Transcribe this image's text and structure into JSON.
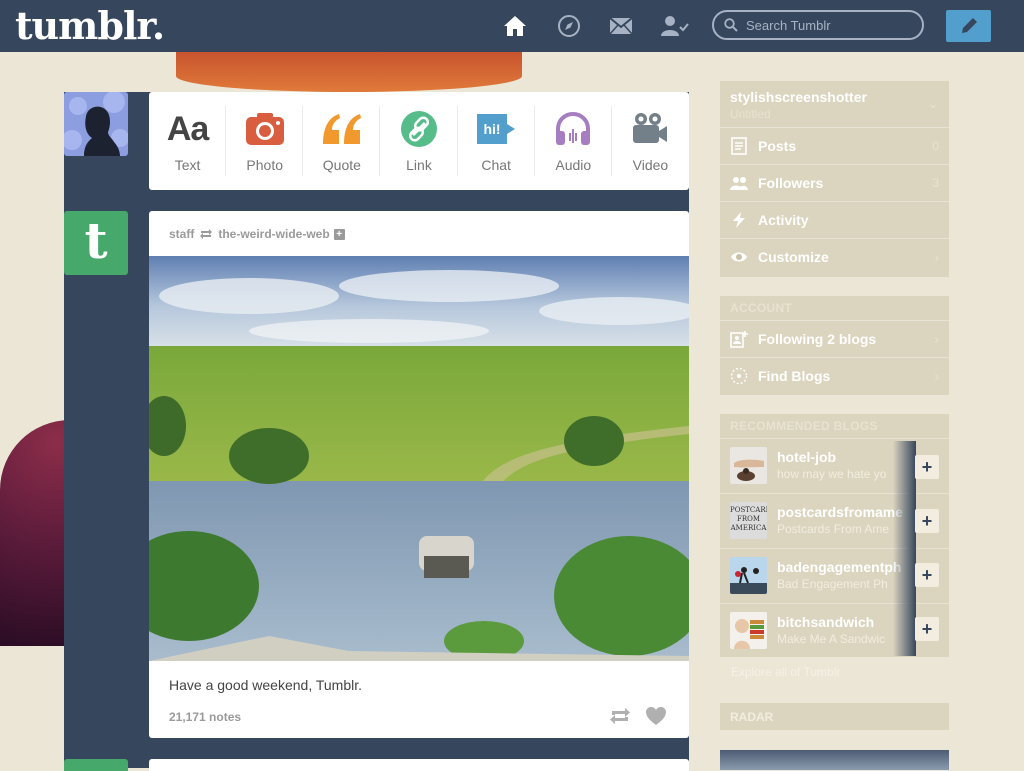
{
  "header": {
    "logo": "tumblr.",
    "search_placeholder": "Search Tumblr",
    "icons": [
      "home-icon",
      "explore-icon",
      "inbox-icon",
      "account-icon",
      "compose-icon"
    ]
  },
  "post_types": [
    {
      "label": "Text",
      "glyph": "Aa",
      "color": "#444444"
    },
    {
      "label": "Photo",
      "color": "#d95e40"
    },
    {
      "label": "Quote",
      "color": "#f2992e"
    },
    {
      "label": "Link",
      "color": "#56bc8a"
    },
    {
      "label": "Chat",
      "glyph": "hi!",
      "color": "#529ecc"
    },
    {
      "label": "Audio",
      "color": "#a77dc2"
    },
    {
      "label": "Video",
      "color": "#748089"
    }
  ],
  "post": {
    "author": "staff",
    "reblogged_from": "the-weird-wide-web",
    "caption": "Have a good weekend, Tumblr.",
    "notes": "21,171 notes"
  },
  "sidebar": {
    "blog": {
      "name": "stylishscreenshotter",
      "subtitle": "Untitled"
    },
    "blog_items": [
      {
        "label": "Posts",
        "count": "0"
      },
      {
        "label": "Followers",
        "count": "3"
      },
      {
        "label": "Activity",
        "count": ""
      },
      {
        "label": "Customize",
        "count": ""
      }
    ],
    "account_title": "ACCOUNT",
    "account_items": [
      {
        "label": "Following 2 blogs"
      },
      {
        "label": "Find Blogs"
      }
    ],
    "recommended_title": "RECOMMENDED BLOGS",
    "recommended": [
      {
        "name": "hotel-job",
        "subtitle": "how may we hate yo"
      },
      {
        "name": "postcardsfromame",
        "subtitle": "Postcards From Ame"
      },
      {
        "name": "badengagementph",
        "subtitle": "Bad Engagement Ph"
      },
      {
        "name": "bitchsandwich",
        "subtitle": "Make Me A Sandwic"
      }
    ],
    "thumb2_text": "POSTCARDS FROM AMERICA",
    "follow_label": "+",
    "explore": "Explore all of Tumblr",
    "radar_title": "RADAR"
  },
  "colors": {
    "nav": "#36465d",
    "accent": "#529ecc",
    "staff": "#46a86a",
    "background": "#ece6d6"
  }
}
